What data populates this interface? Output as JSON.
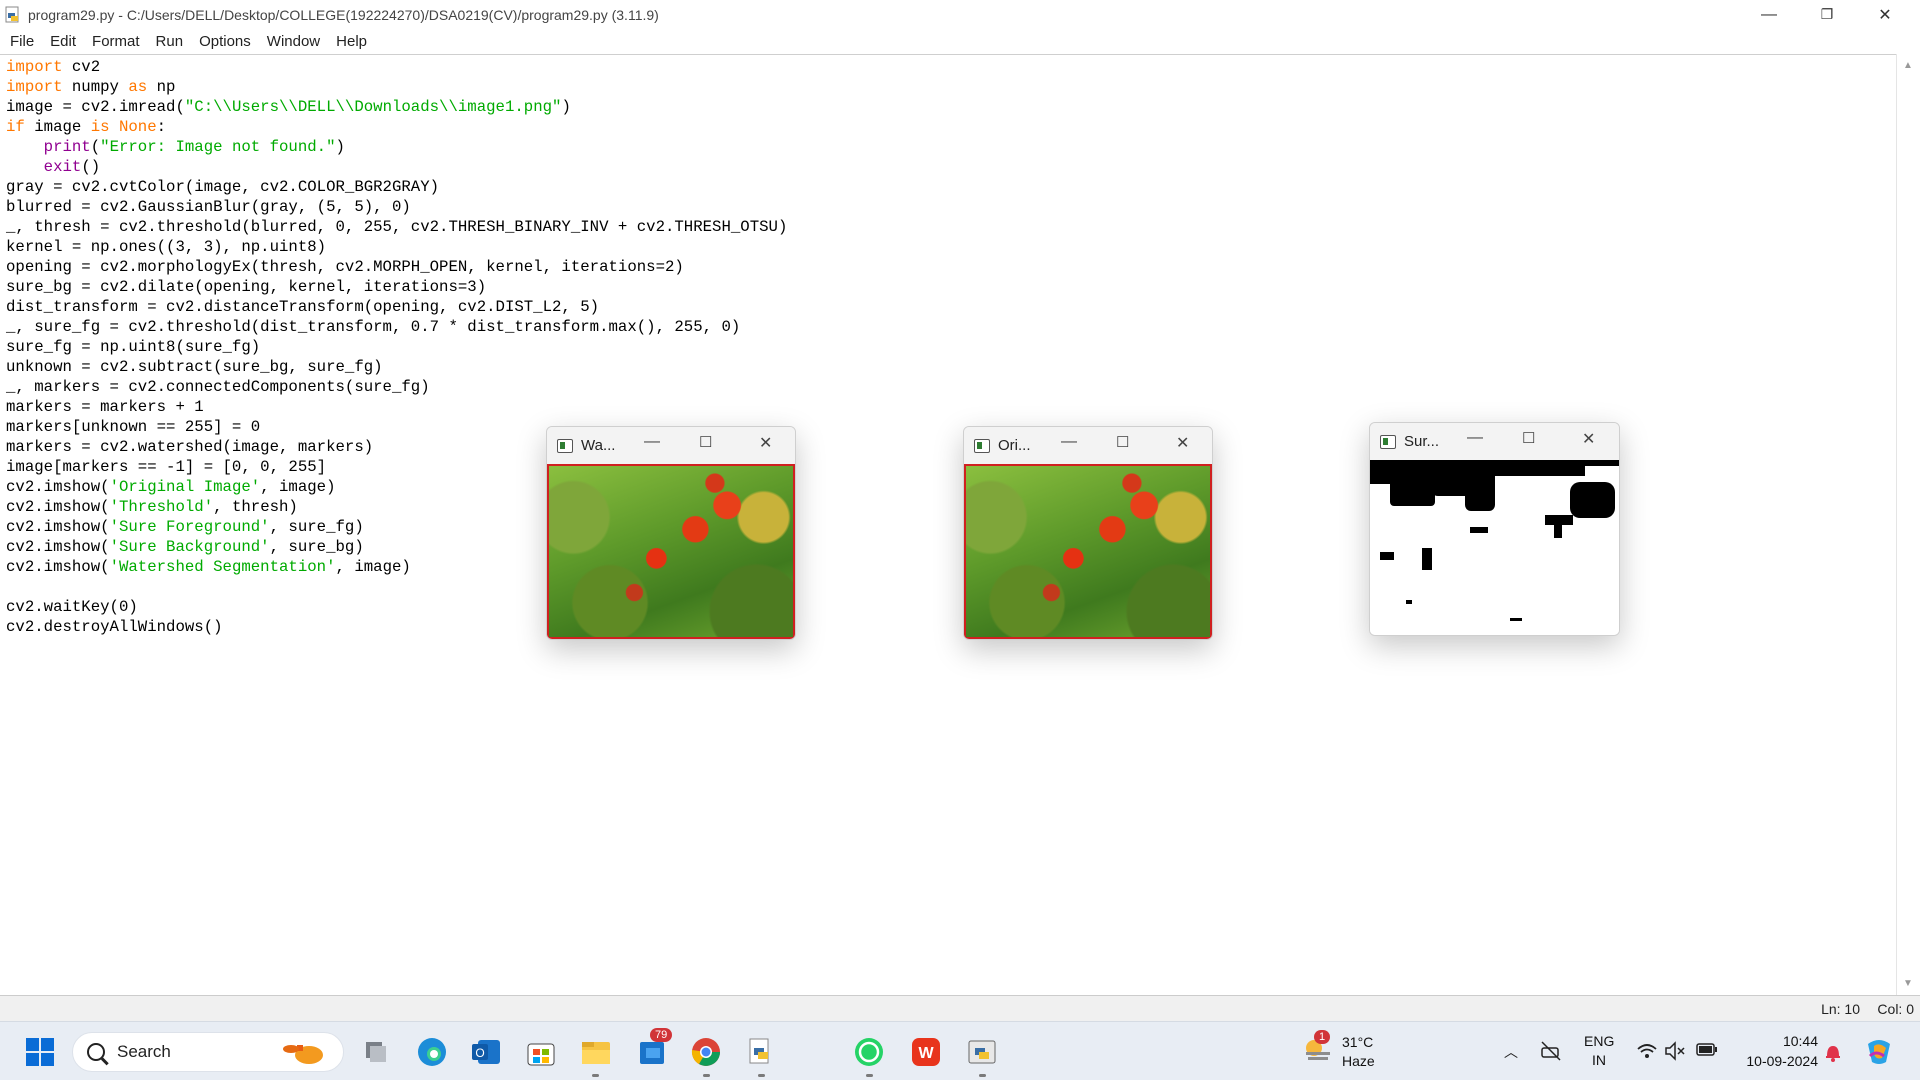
{
  "window": {
    "title": "program29.py - C:/Users/DELL/Desktop/COLLEGE(192224270)/DSA0219(CV)/program29.py (3.11.9)",
    "minimize": "—",
    "maximize": "❐",
    "close": "✕"
  },
  "menu": [
    "File",
    "Edit",
    "Format",
    "Run",
    "Options",
    "Window",
    "Help"
  ],
  "code_lines": [
    "import cv2",
    "import numpy as np",
    "image = cv2.imread(\"C:\\\\Users\\\\DELL\\\\Downloads\\\\image1.png\")",
    "if image is None:",
    "    print(\"Error: Image not found.\")",
    "    exit()",
    "gray = cv2.cvtColor(image, cv2.COLOR_BGR2GRAY)",
    "blurred = cv2.GaussianBlur(gray, (5, 5), 0)",
    "_, thresh = cv2.threshold(blurred, 0, 255, cv2.THRESH_BINARY_INV + cv2.THRESH_OTSU)",
    "kernel = np.ones((3, 3), np.uint8)",
    "opening = cv2.morphologyEx(thresh, cv2.MORPH_OPEN, kernel, iterations=2)",
    "sure_bg = cv2.dilate(opening, kernel, iterations=3)",
    "dist_transform = cv2.distanceTransform(opening, cv2.DIST_L2, 5)",
    "_, sure_fg = cv2.threshold(dist_transform, 0.7 * dist_transform.max(), 255, 0)",
    "sure_fg = np.uint8(sure_fg)",
    "unknown = cv2.subtract(sure_bg, sure_fg)",
    "_, markers = cv2.connectedComponents(sure_fg)",
    "markers = markers + 1",
    "markers[unknown == 255] = 0",
    "markers = cv2.watershed(image, markers)",
    "image[markers == -1] = [0, 0, 255]",
    "cv2.imshow('Original Image', image)",
    "cv2.imshow('Threshold', thresh)",
    "cv2.imshow('Sure Foreground', sure_fg)",
    "cv2.imshow('Sure Background', sure_bg)",
    "cv2.imshow('Watershed Segmentation', image)",
    "",
    "cv2.waitKey(0)",
    "cv2.destroyAllWindows()"
  ],
  "status": {
    "line": "Ln: 10",
    "col": "Col: 0"
  },
  "cv_windows": [
    {
      "title": "Wa...",
      "image": "tomato-plant"
    },
    {
      "title": "Ori...",
      "image": "tomato-plant"
    },
    {
      "title": "Sur...",
      "image": "binary-mask"
    }
  ],
  "taskbar": {
    "search_label": "Search",
    "pinned_icons": [
      "task-view-icon",
      "edge-icon",
      "outlook-icon",
      "store-icon",
      "file-explorer-icon",
      "mail-icon",
      "chrome-icon",
      "python-icon",
      "whatsapp-icon",
      "wps-icon",
      "idle-icon"
    ],
    "mail_badge": "79",
    "weather": {
      "badge": "1",
      "temp": "31°C",
      "condition": "Haze"
    },
    "lang_top": "ENG",
    "lang_bottom": "IN",
    "time": "10:44",
    "date": "10-09-2024"
  },
  "colors": {
    "keyword": "#ff7700",
    "builtin": "#900090",
    "string": "#00aa00",
    "win_border": "#d02020"
  }
}
